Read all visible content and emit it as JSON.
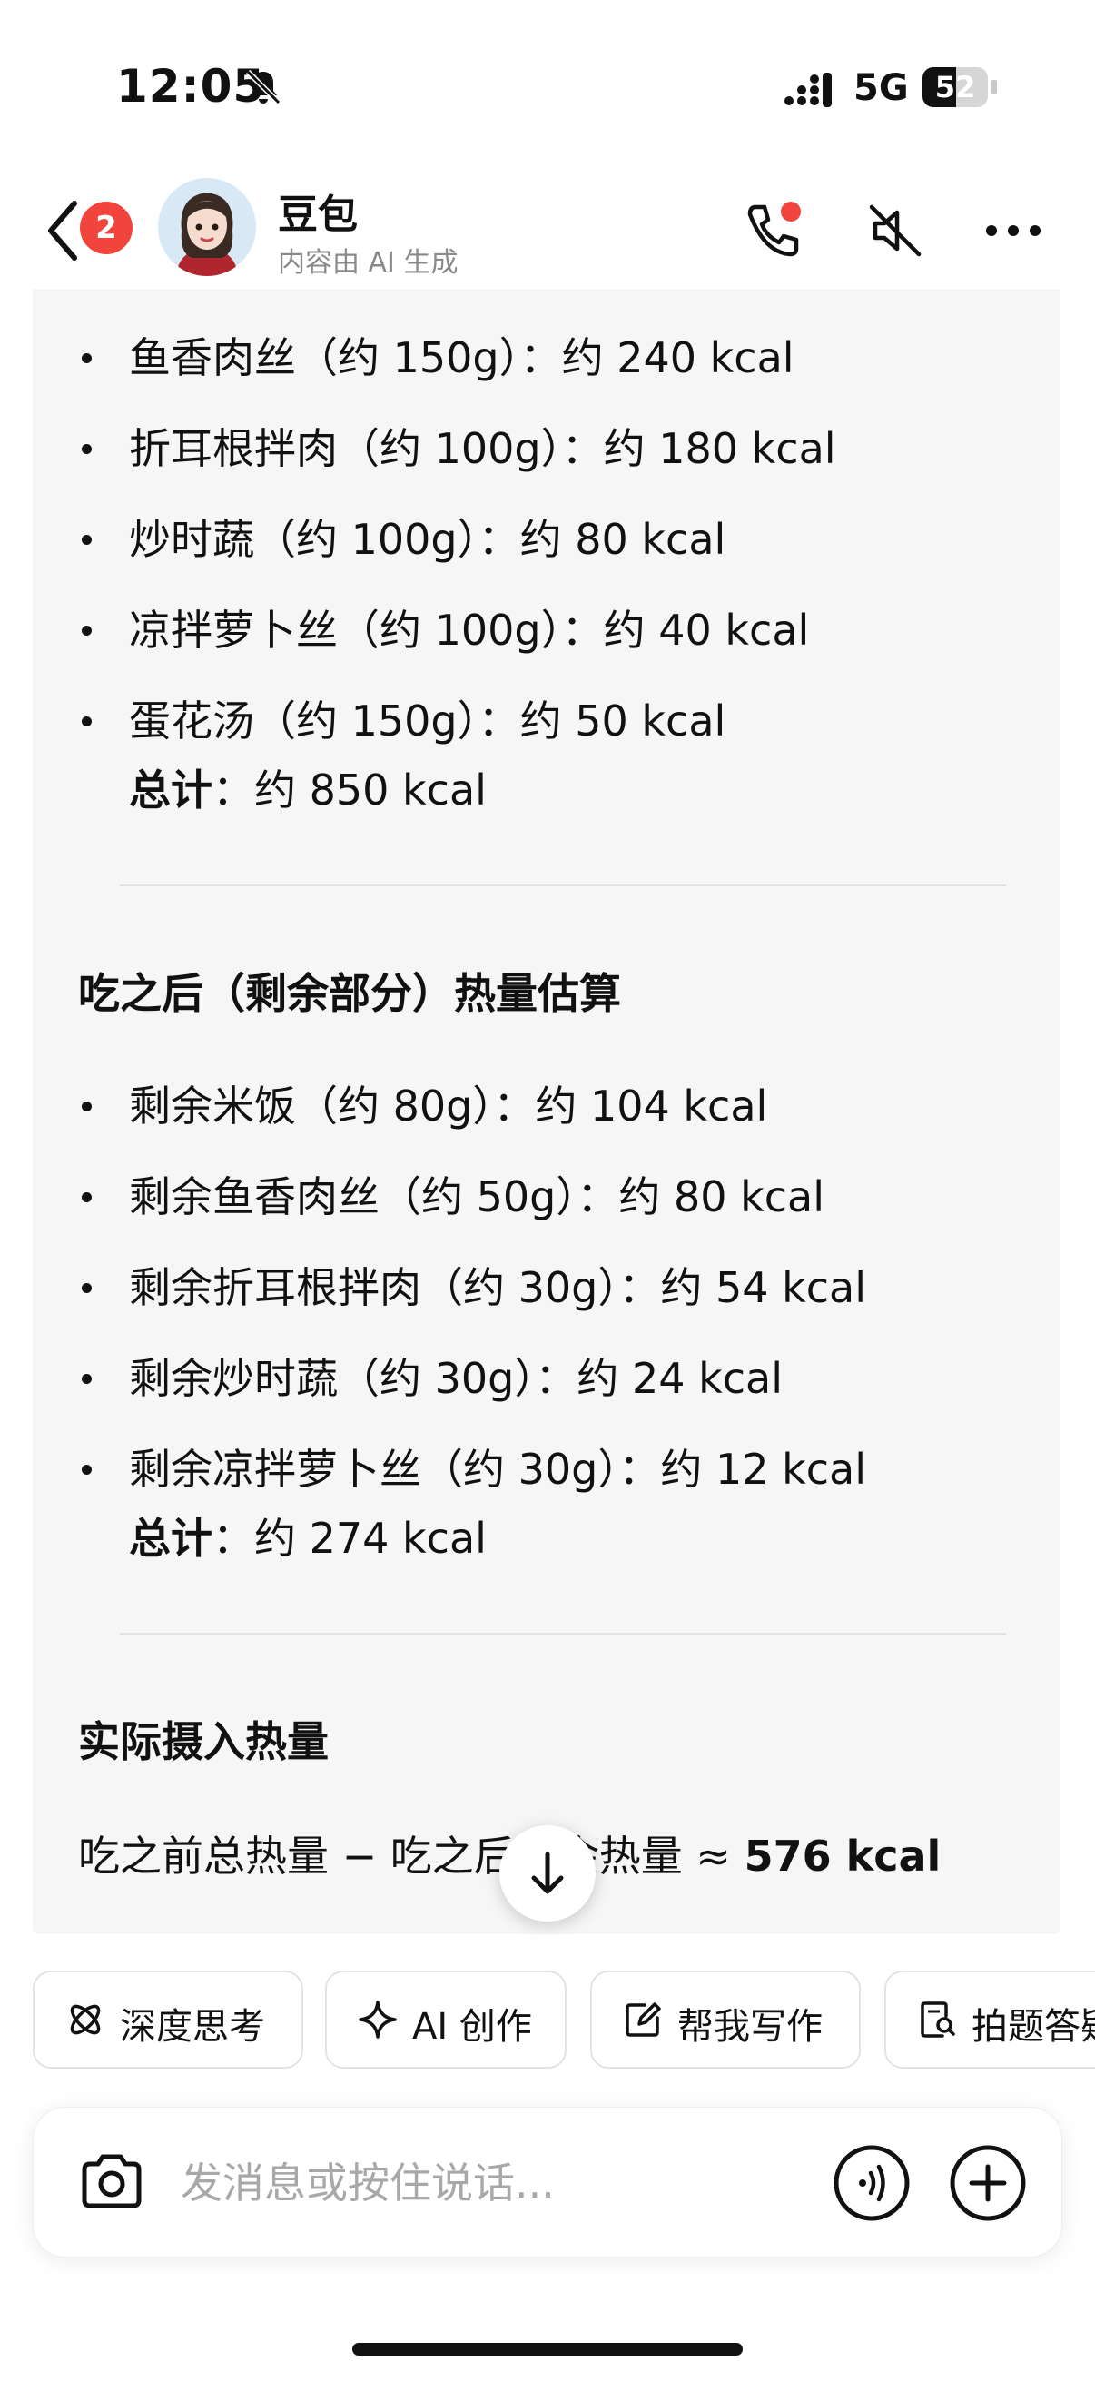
{
  "status_bar": {
    "time": "12:05",
    "network": "5G",
    "battery_level": 52,
    "battery_text": "52",
    "icons": [
      "bell-slash-icon",
      "signal-icon",
      "battery-icon"
    ]
  },
  "header": {
    "back_badge": "2",
    "bot_name": "豆包",
    "subtitle": "内容由 AI 生成",
    "icons": [
      "back-chevron-icon",
      "phone-icon",
      "speaker-mute-icon",
      "more-dots-icon"
    ],
    "accent_red": "#f0443c"
  },
  "message": {
    "before_items": [
      "鱼香肉丝（约 150g）：约 240 kcal",
      "折耳根拌肉（约 100g）：约 180 kcal",
      "炒时蔬（约 100g）：约 80 kcal",
      "凉拌萝卜丝（约 100g）：约 40 kcal",
      "蛋花汤（约 150g）：约 50 kcal"
    ],
    "before_total_label": "总计",
    "before_total_value": "：约 850 kcal",
    "after_heading": "吃之后（剩余部分）热量估算",
    "after_items": [
      "剩余米饭（约 80g）：约 104 kcal",
      "剩余鱼香肉丝（约 50g）：约 80 kcal",
      "剩余折耳根拌肉（约 30g）：约 54 kcal",
      "剩余炒时蔬（约 30g）：约 24 kcal",
      "剩余凉拌萝卜丝（约 30g）：约 12 kcal"
    ],
    "after_total_label": "总计",
    "after_total_value": "：约 274 kcal",
    "actual_heading": "实际摄入热量",
    "formula_text": "吃之前总热量 − 吃之后剩余热量 ≈ ",
    "formula_result": "576 kcal"
  },
  "chips": [
    {
      "label": "深度思考",
      "icon": "atom-icon"
    },
    {
      "label": "AI 创作",
      "icon": "sparkle-icon"
    },
    {
      "label": "帮我写作",
      "icon": "pencil-square-icon"
    },
    {
      "label": "拍题答疑",
      "icon": "document-search-icon"
    }
  ],
  "composer": {
    "placeholder": "发消息或按住说话...",
    "icons": [
      "camera-icon",
      "voice-wave-icon",
      "plus-circle-icon"
    ]
  },
  "scroll_down_icon": "arrow-down-icon"
}
